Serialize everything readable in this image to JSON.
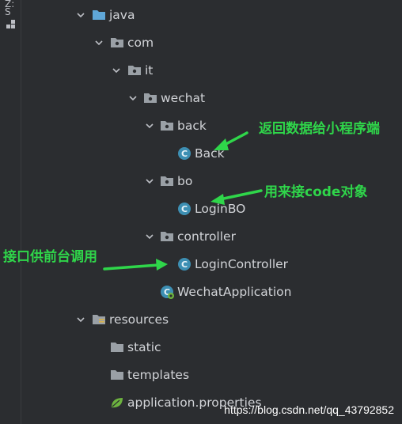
{
  "gutter": {
    "label": "Z: S"
  },
  "tree": {
    "java": "java",
    "com": "com",
    "it": "it",
    "wechat": "wechat",
    "back": "back",
    "back_class": "Back",
    "bo": "bo",
    "bo_class": "LoginBO",
    "controller": "controller",
    "controller_class": "LoginController",
    "app_class": "WechatApplication",
    "resources": "resources",
    "static": "static",
    "templates": "templates",
    "props": "application.properties"
  },
  "annotations": {
    "back_note": "返回数据给小程序端",
    "bo_note": "用来接code对象",
    "controller_note": "接口供前台调用"
  },
  "watermark": "https://blog.csdn.net/qq_43792852",
  "colors": {
    "annotation": "#2fd64a",
    "class_icon": "#3d8fb3",
    "folder": "#9aa0a6",
    "source_folder": "#5fa7d8"
  }
}
